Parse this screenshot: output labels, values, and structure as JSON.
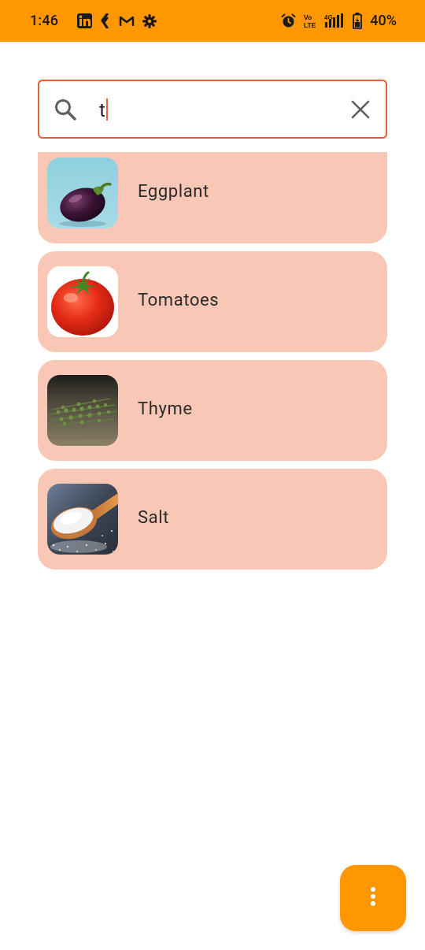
{
  "status_bar": {
    "time": "1:46",
    "battery_percent": "40%",
    "left_icons": [
      "linkedin-icon",
      "k-app-icon",
      "gmail-icon",
      "settings-gear-icon"
    ],
    "right_icons": [
      "alarm-icon",
      "volte-icon",
      "4g-signal-icon",
      "battery-icon"
    ]
  },
  "search": {
    "value": "t",
    "search_icon": "search-icon",
    "clear_icon": "close-icon"
  },
  "results": [
    {
      "label": "Eggplant",
      "image": "eggplant-image"
    },
    {
      "label": "Tomatoes",
      "image": "tomato-image"
    },
    {
      "label": "Thyme",
      "image": "thyme-image"
    },
    {
      "label": "Salt",
      "image": "salt-image"
    }
  ],
  "fab": {
    "icon": "more-vertical-icon"
  },
  "colors": {
    "accent": "#FF9800",
    "card_background": "#F8C7B6",
    "search_border": "#E4603A"
  }
}
